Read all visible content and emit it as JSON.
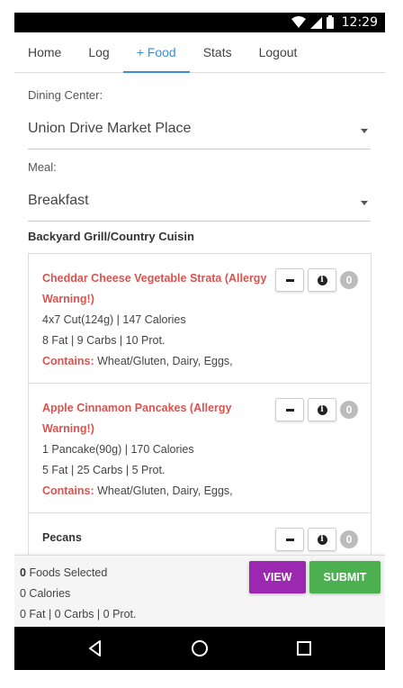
{
  "status_bar": {
    "time": "12:29"
  },
  "nav": {
    "items": [
      {
        "label": "Home"
      },
      {
        "label": "Log"
      },
      {
        "label": "+ Food"
      },
      {
        "label": "Stats"
      },
      {
        "label": "Logout"
      }
    ],
    "active_index": 2,
    "active_color": "#3b8ed6"
  },
  "form": {
    "dining_center_label": "Dining Center:",
    "dining_center_value": "Union Drive Market Place",
    "meal_label": "Meal:",
    "meal_value": "Breakfast"
  },
  "section": {
    "title": "Backyard Grill/Country Cuisin"
  },
  "foods": [
    {
      "name": "Cheddar Cheese Vegetable Strata (Allergy Warning!)",
      "serving": "4x7 Cut(124g) | 147 Calories",
      "macros": "8 Fat | 9 Carbs | 10 Prot.",
      "contains_label": "Contains:",
      "contains": "Wheat/Gluten, Dairy, Eggs,",
      "count": "0"
    },
    {
      "name": "Apple Cinnamon Pancakes (Allergy Warning!)",
      "serving": "1 Pancake(90g) | 170 Calories",
      "macros": "5 Fat | 25 Carbs | 5 Prot.",
      "contains_label": "Contains:",
      "contains": "Wheat/Gluten, Dairy, Eggs,",
      "count": "0"
    },
    {
      "name": "Pecans",
      "count": "0"
    }
  ],
  "summary": {
    "foods_selected_count": "0",
    "foods_selected_label": "Foods Selected",
    "calories": "0 Calories",
    "macros": "0 Fat | 0 Carbs | 0 Prot."
  },
  "buttons": {
    "view": "VIEW",
    "submit": "SUBMIT",
    "view_color": "#9c27b0",
    "submit_color": "#4caf50"
  },
  "colors": {
    "allergy_warning": "#d9534f"
  }
}
